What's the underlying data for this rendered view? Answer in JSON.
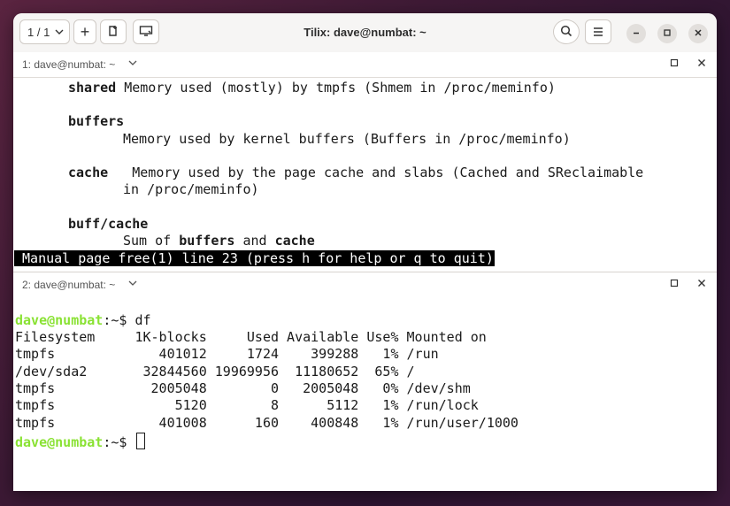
{
  "window": {
    "title": "Tilix: dave@numbat: ~",
    "session_counter": "1 / 1",
    "add_label": "+"
  },
  "icons": [
    "chevron-down-icon",
    "add-icon",
    "add-terminal-icon",
    "sync-input-icon",
    "search-icon",
    "hamburger-menu-icon",
    "minimize-icon",
    "maximize-icon",
    "close-icon"
  ],
  "panes": [
    {
      "label": "1: dave@numbat: ~"
    },
    {
      "label": "2: dave@numbat: ~"
    }
  ],
  "man": {
    "shared_term": "shared",
    "shared_desc": " Memory used (mostly) by tmpfs (Shmem in /proc/meminfo)",
    "buffers_term": "buffers",
    "buffers_desc": "Memory used by kernel buffers (Buffers in /proc/meminfo)",
    "cache_term": "cache",
    "cache_desc1": "   Memory used by the page cache and slabs (Cached and SReclaimable",
    "cache_desc2": "in /proc/meminfo)",
    "buffcache_term": "buff/cache",
    "sum_pre": "Sum of ",
    "sum_b1": "buffers",
    "sum_mid": " and ",
    "sum_b2": "cache",
    "status": " Manual page free(1) line 23 (press h for help or q to quit)"
  },
  "shell": {
    "prompt_user": "dave@numbat",
    "prompt_path": ":~$ ",
    "command": "df",
    "df_header": "Filesystem     1K-blocks     Used Available Use% Mounted on",
    "df_rows": [
      "tmpfs             401012     1724    399288   1% /run",
      "/dev/sda2       32844560 19969956  11180652  65% /",
      "tmpfs            2005048        0   2005048   0% /dev/shm",
      "tmpfs               5120        8      5112   1% /run/lock",
      "tmpfs             401008      160    400848   1% /run/user/1000"
    ]
  }
}
